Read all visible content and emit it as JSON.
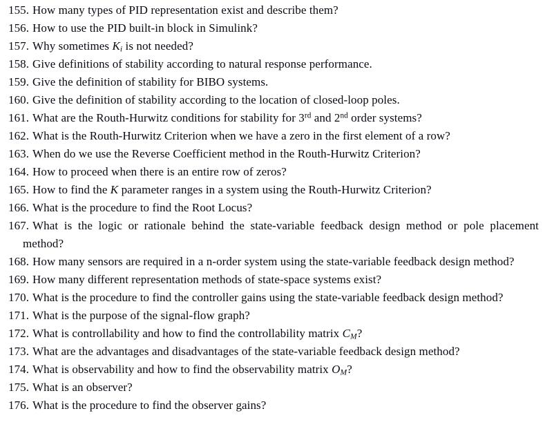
{
  "document": {
    "type": "numbered-question-list",
    "background_color": "#ffffff",
    "text_color": "#0a0a14",
    "start_number": 155,
    "end_number": 176,
    "alignment": "justified"
  },
  "questions": [
    {
      "number": "155.",
      "text": "How many types of PID representation exist and describe them?",
      "parts": [
        {
          "kind": "text",
          "value": "How many types of PID representation exist and describe them?"
        }
      ]
    },
    {
      "number": "156.",
      "text": "How to use the PID built-in block in Simulink?",
      "parts": [
        {
          "kind": "text",
          "value": "How to use the PID built-in block in Simulink?"
        }
      ]
    },
    {
      "number": "157.",
      "text": "Why sometimes Ki is not needed?",
      "parts": [
        {
          "kind": "text",
          "value": "Why sometimes "
        },
        {
          "kind": "italic",
          "value": "K"
        },
        {
          "kind": "subscript",
          "value": "i"
        },
        {
          "kind": "text",
          "value": " is not needed?"
        }
      ]
    },
    {
      "number": "158.",
      "text": "Give definitions of stability according to natural response performance.",
      "parts": [
        {
          "kind": "text",
          "value": "Give definitions of stability according to natural response performance."
        }
      ]
    },
    {
      "number": "159.",
      "text": "Give the definition of stability for BIBO systems.",
      "parts": [
        {
          "kind": "text",
          "value": "Give the definition of stability for BIBO systems."
        }
      ]
    },
    {
      "number": "160.",
      "text": "Give the definition of stability according to the location of closed-loop poles.",
      "parts": [
        {
          "kind": "text",
          "value": "Give the definition of stability according to the location of closed-loop poles."
        }
      ]
    },
    {
      "number": "161.",
      "text": "What are the Routh-Hurwitz conditions for stability for 3rd and 2nd order systems?",
      "parts": [
        {
          "kind": "text",
          "value": "What are the Routh-Hurwitz conditions for stability for 3"
        },
        {
          "kind": "superscript",
          "value": "rd"
        },
        {
          "kind": "text",
          "value": " and 2"
        },
        {
          "kind": "superscript",
          "value": "nd"
        },
        {
          "kind": "text",
          "value": " order systems?"
        }
      ]
    },
    {
      "number": "162.",
      "text": "What is the Routh-Hurwitz Criterion when we have a zero in the first element of a row?",
      "parts": [
        {
          "kind": "text",
          "value": "What is the Routh-Hurwitz Criterion when we have a zero in the first element of a row?"
        }
      ]
    },
    {
      "number": "163.",
      "text": "When do we use the Reverse Coefficient method in the Routh-Hurwitz Criterion?",
      "parts": [
        {
          "kind": "text",
          "value": "When do we use the Reverse Coefficient method in the Routh-Hurwitz Criterion?"
        }
      ]
    },
    {
      "number": "164.",
      "text": "How to proceed when there is an entire row of zeros?",
      "parts": [
        {
          "kind": "text",
          "value": "How to proceed when there is an entire row of zeros?"
        }
      ]
    },
    {
      "number": "165.",
      "text": "How to find the K parameter ranges in a system using the Routh-Hurwitz Criterion?",
      "parts": [
        {
          "kind": "text",
          "value": "How to find the "
        },
        {
          "kind": "italic",
          "value": "K"
        },
        {
          "kind": "text",
          "value": " parameter ranges in a system using the Routh-Hurwitz Criterion?"
        }
      ]
    },
    {
      "number": "166.",
      "text": "What is the procedure to find the Root Locus?",
      "parts": [
        {
          "kind": "text",
          "value": "What is the procedure to find the Root Locus?"
        }
      ]
    },
    {
      "number": "167.",
      "text": "What is the logic or rationale behind the state-variable feedback design method or pole placement method?",
      "parts": [
        {
          "kind": "text",
          "value": "What is the logic or rationale behind the state-variable feedback design method or pole placement method?"
        }
      ]
    },
    {
      "number": "168.",
      "text": "How many sensors are required in a n-order system using the state-variable feedback design method?",
      "parts": [
        {
          "kind": "text",
          "value": "How many sensors are required in a n-order system using the state-variable feedback design method?"
        }
      ]
    },
    {
      "number": "169.",
      "text": "How many different representation methods of state-space systems exist?",
      "parts": [
        {
          "kind": "text",
          "value": "How many different representation methods of state-space systems exist?"
        }
      ]
    },
    {
      "number": "170.",
      "text": "What is the procedure to find the controller gains using the state-variable feedback design method?",
      "parts": [
        {
          "kind": "text",
          "value": "What is the procedure to find the controller gains using the state-variable feedback design method?"
        }
      ]
    },
    {
      "number": "171.",
      "text": "What is the purpose of the signal-flow graph?",
      "parts": [
        {
          "kind": "text",
          "value": "What is the purpose of the signal-flow graph?"
        }
      ]
    },
    {
      "number": "172.",
      "text": "What is controllability and how to find the controllability matrix CM?",
      "parts": [
        {
          "kind": "text",
          "value": "What is controllability and how to find the controllability matrix "
        },
        {
          "kind": "italic",
          "value": "C"
        },
        {
          "kind": "subscript",
          "value": "M"
        },
        {
          "kind": "text",
          "value": "?"
        }
      ]
    },
    {
      "number": "173.",
      "text": "What are the advantages and disadvantages of the state-variable feedback design method?",
      "parts": [
        {
          "kind": "text",
          "value": "What are the advantages and disadvantages of the state-variable feedback design method?"
        }
      ]
    },
    {
      "number": "174.",
      "text": "What is observability and how to find the observability matrix OM?",
      "parts": [
        {
          "kind": "text",
          "value": "What is observability and how to find the observability matrix "
        },
        {
          "kind": "italic",
          "value": "O"
        },
        {
          "kind": "subscript",
          "value": "M"
        },
        {
          "kind": "text",
          "value": "?"
        }
      ]
    },
    {
      "number": "175.",
      "text": "What is an observer?",
      "parts": [
        {
          "kind": "text",
          "value": "What is an observer?"
        }
      ]
    },
    {
      "number": "176.",
      "text": "What is the procedure to find the observer gains?",
      "parts": [
        {
          "kind": "text",
          "value": "What is the procedure to find the observer gains?"
        }
      ]
    }
  ]
}
